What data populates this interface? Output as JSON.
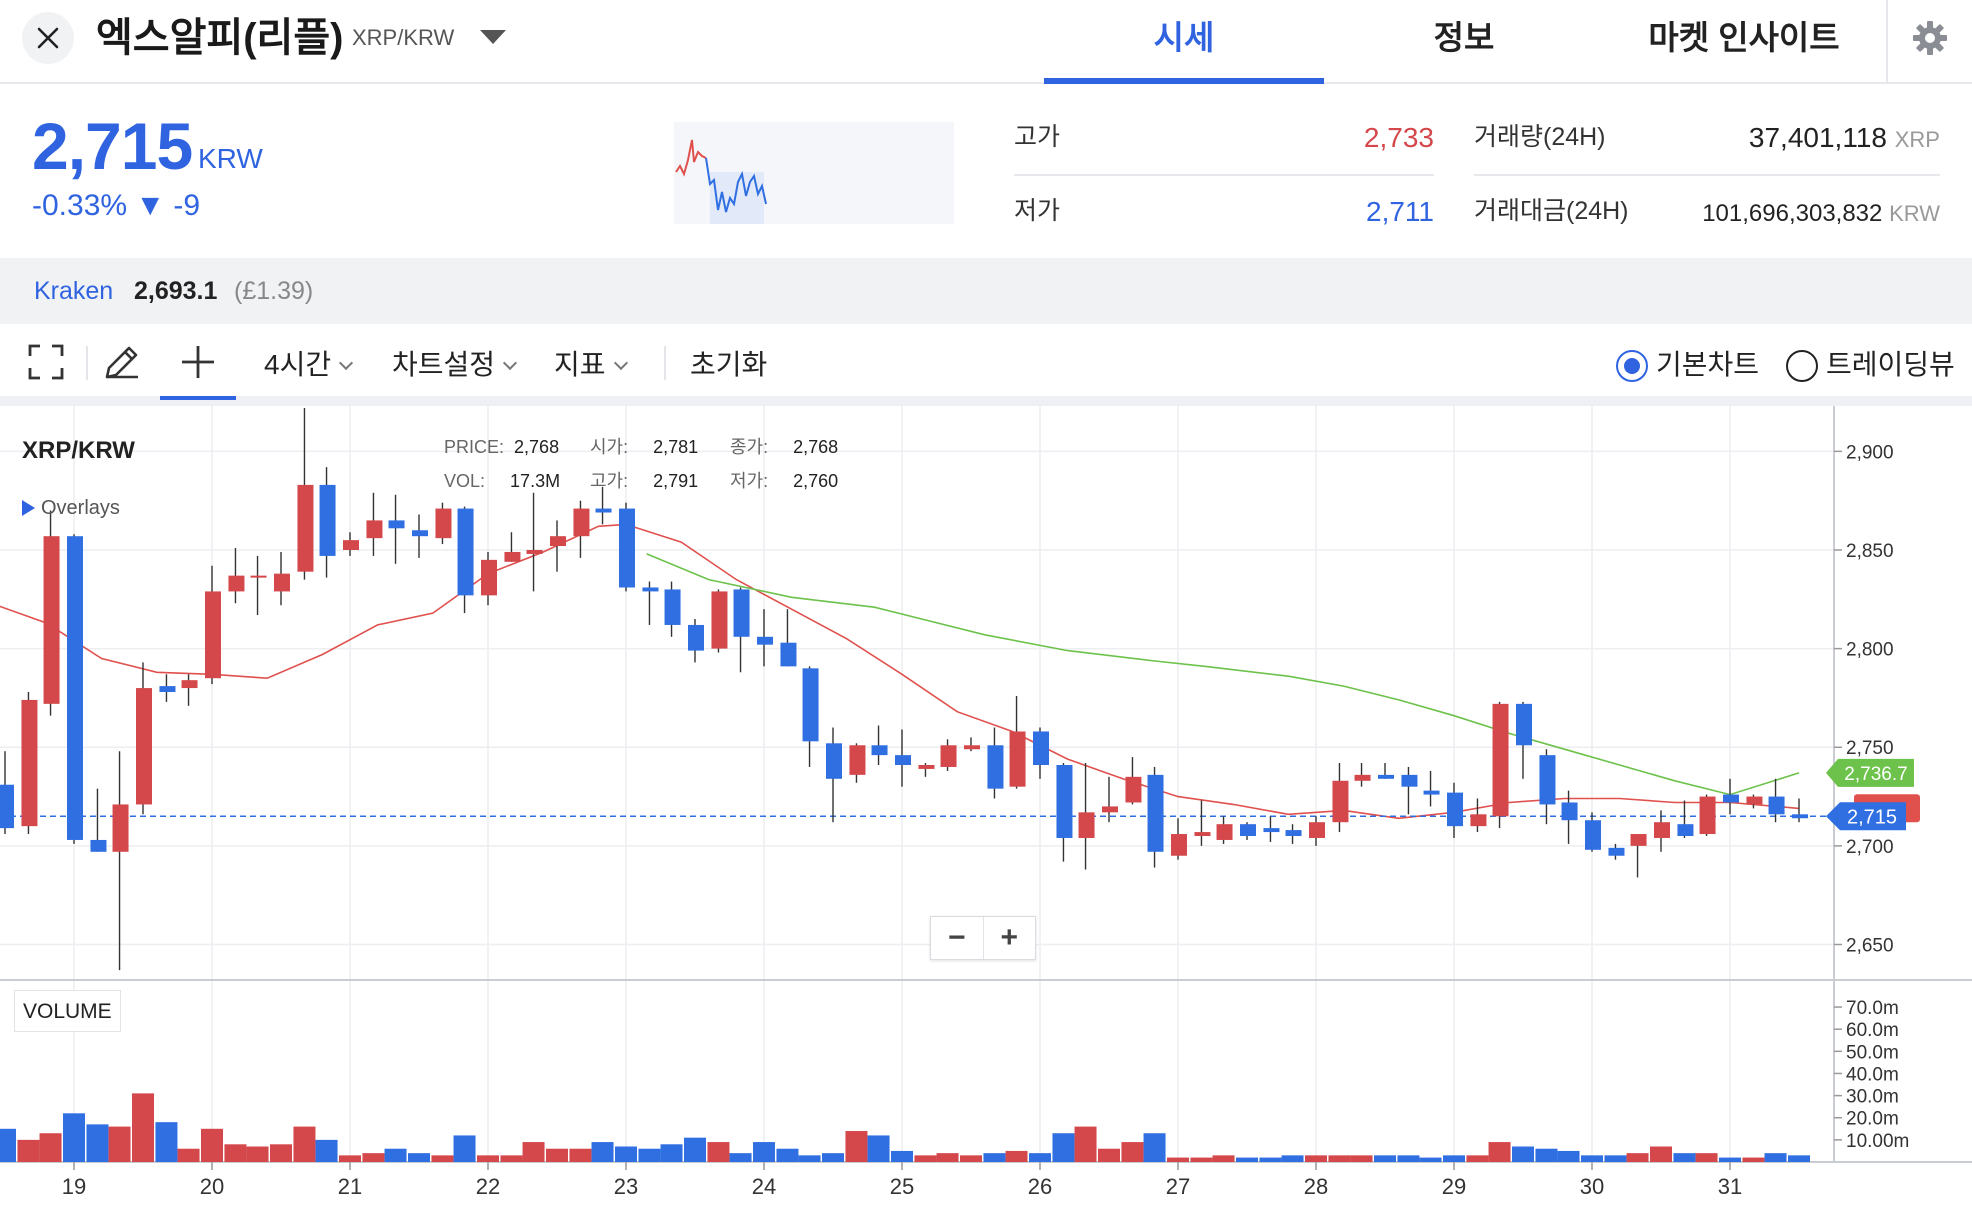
{
  "header": {
    "coin_name": "엑스알피(리플)",
    "pair": "XRP/KRW",
    "tabs": [
      {
        "label": "시세",
        "active": true
      },
      {
        "label": "정보",
        "active": false
      },
      {
        "label": "마켓 인사이트",
        "active": false
      }
    ],
    "icons": {
      "close": "close-icon",
      "caret": "caret-down-icon",
      "settings": "gear-icon"
    }
  },
  "summary": {
    "price": "2,715",
    "unit": "KRW",
    "change": "-0.33% ▼ -9",
    "high_label": "고가",
    "high_value": "2,733",
    "low_label": "저가",
    "low_value": "2,711",
    "volume_label": "거래량(24H)",
    "volume_value": "37,401,118",
    "volume_unit": "XRP",
    "amount_label": "거래대금(24H)",
    "amount_value": "101,696,303,832",
    "amount_unit": "KRW"
  },
  "kraken": {
    "name": "Kraken",
    "price": "2,693.1",
    "gbp": "(£1.39)"
  },
  "toolbar": {
    "interval": "4시간",
    "chart_settings": "차트설정",
    "indicators": "지표",
    "reset": "초기화",
    "radio_basic": "기본차트",
    "radio_tradingview": "트레이딩뷰",
    "selected_chart": "기본차트",
    "icons": [
      "fullscreen-icon",
      "pencil-icon",
      "crosshair-icon"
    ]
  },
  "chart": {
    "title": "XRP/KRW",
    "overlays": "Overlays",
    "info_price_label": "PRICE:",
    "info_price": "2,768",
    "info_open_label": "시가:",
    "info_open": "2,781",
    "info_close_label": "종가:",
    "info_close": "2,768",
    "info_vol_label": "VOL:",
    "info_vol": "17.3M",
    "info_high_label": "고가:",
    "info_high": "2,791",
    "info_low_label": "저가:",
    "info_low": "2,760",
    "zoom_out": "−",
    "zoom_in": "+",
    "volume_label": "VOLUME"
  },
  "colors": {
    "accent": "#2f63e0",
    "up": "#d4484b",
    "down": "#2f6fe2",
    "ma_short": "#e0514e",
    "ma_long": "#6cc24a"
  },
  "chart_data": {
    "type": "candlestick",
    "title": "XRP/KRW",
    "interval": "4시간",
    "x_ticks": [
      "19",
      "20",
      "21",
      "22",
      "23",
      "24",
      "25",
      "26",
      "27",
      "28",
      "29",
      "30",
      "31"
    ],
    "y_ticks": [
      "2,900",
      "2,850",
      "2,800",
      "2,750",
      "2,700",
      "2,650"
    ],
    "ylim": [
      2632,
      2923
    ],
    "volume_ticks": [
      "70.0m",
      "60.0m",
      "50.0m",
      "40.0m",
      "30.0m",
      "20.0m",
      "10.00m"
    ],
    "volume_max_m": 75,
    "candles": [
      {
        "d": 18.5,
        "o": 2731,
        "h": 2748,
        "l": 2706,
        "c": 2709
      },
      {
        "d": 18.67,
        "o": 2710,
        "h": 2778,
        "l": 2706,
        "c": 2774
      },
      {
        "d": 18.83,
        "o": 2772,
        "h": 2870,
        "l": 2766,
        "c": 2857
      },
      {
        "d": 19.0,
        "o": 2857,
        "h": 2858,
        "l": 2701,
        "c": 2703
      },
      {
        "d": 19.17,
        "o": 2703,
        "h": 2729,
        "l": 2697,
        "c": 2697
      },
      {
        "d": 19.33,
        "o": 2697,
        "h": 2748,
        "l": 2637,
        "c": 2721
      },
      {
        "d": 19.5,
        "o": 2721,
        "h": 2793,
        "l": 2716,
        "c": 2780
      },
      {
        "d": 19.67,
        "o": 2781,
        "h": 2787,
        "l": 2773,
        "c": 2778
      },
      {
        "d": 19.83,
        "o": 2780,
        "h": 2787,
        "l": 2771,
        "c": 2784
      },
      {
        "d": 20.0,
        "o": 2785,
        "h": 2842,
        "l": 2782,
        "c": 2829
      },
      {
        "d": 20.17,
        "o": 2829,
        "h": 2851,
        "l": 2823,
        "c": 2837
      },
      {
        "d": 20.33,
        "o": 2837,
        "h": 2847,
        "l": 2817,
        "c": 2837
      },
      {
        "d": 20.5,
        "o": 2829,
        "h": 2849,
        "l": 2822,
        "c": 2838
      },
      {
        "d": 20.67,
        "o": 2839,
        "h": 2922,
        "l": 2835,
        "c": 2883
      },
      {
        "d": 20.83,
        "o": 2883,
        "h": 2892,
        "l": 2836,
        "c": 2847
      },
      {
        "d": 21.0,
        "o": 2850,
        "h": 2859,
        "l": 2847,
        "c": 2855
      },
      {
        "d": 21.17,
        "o": 2856,
        "h": 2879,
        "l": 2847,
        "c": 2865
      },
      {
        "d": 21.33,
        "o": 2865,
        "h": 2878,
        "l": 2843,
        "c": 2861
      },
      {
        "d": 21.5,
        "o": 2860,
        "h": 2868,
        "l": 2846,
        "c": 2857
      },
      {
        "d": 21.67,
        "o": 2856,
        "h": 2874,
        "l": 2853,
        "c": 2871
      },
      {
        "d": 21.83,
        "o": 2871,
        "h": 2872,
        "l": 2818,
        "c": 2827
      },
      {
        "d": 22.0,
        "o": 2827,
        "h": 2849,
        "l": 2822,
        "c": 2845
      },
      {
        "d": 22.17,
        "o": 2844,
        "h": 2859,
        "l": 2844,
        "c": 2849
      },
      {
        "d": 22.33,
        "o": 2848,
        "h": 2879,
        "l": 2829,
        "c": 2850
      },
      {
        "d": 22.5,
        "o": 2852,
        "h": 2865,
        "l": 2839,
        "c": 2857
      },
      {
        "d": 22.67,
        "o": 2857,
        "h": 2875,
        "l": 2846,
        "c": 2871
      },
      {
        "d": 22.83,
        "o": 2871,
        "h": 2882,
        "l": 2863,
        "c": 2869
      },
      {
        "d": 23.0,
        "o": 2871,
        "h": 2874,
        "l": 2829,
        "c": 2831
      },
      {
        "d": 23.17,
        "o": 2831,
        "h": 2834,
        "l": 2812,
        "c": 2829
      },
      {
        "d": 23.33,
        "o": 2830,
        "h": 2834,
        "l": 2806,
        "c": 2812
      },
      {
        "d": 23.5,
        "o": 2812,
        "h": 2815,
        "l": 2793,
        "c": 2799
      },
      {
        "d": 23.67,
        "o": 2800,
        "h": 2830,
        "l": 2798,
        "c": 2829
      },
      {
        "d": 23.83,
        "o": 2830,
        "h": 2831,
        "l": 2788,
        "c": 2806
      },
      {
        "d": 24.0,
        "o": 2806,
        "h": 2820,
        "l": 2791,
        "c": 2802
      },
      {
        "d": 24.17,
        "o": 2803,
        "h": 2820,
        "l": 2791,
        "c": 2791
      },
      {
        "d": 24.33,
        "o": 2790,
        "h": 2791,
        "l": 2740,
        "c": 2753
      },
      {
        "d": 24.5,
        "o": 2752,
        "h": 2760,
        "l": 2712,
        "c": 2734
      },
      {
        "d": 24.67,
        "o": 2736,
        "h": 2752,
        "l": 2732,
        "c": 2751
      },
      {
        "d": 24.83,
        "o": 2751,
        "h": 2761,
        "l": 2741,
        "c": 2746
      },
      {
        "d": 25.0,
        "o": 2746,
        "h": 2759,
        "l": 2730,
        "c": 2741
      },
      {
        "d": 25.17,
        "o": 2739,
        "h": 2742,
        "l": 2735,
        "c": 2741
      },
      {
        "d": 25.33,
        "o": 2740,
        "h": 2754,
        "l": 2738,
        "c": 2751
      },
      {
        "d": 25.5,
        "o": 2749,
        "h": 2755,
        "l": 2748,
        "c": 2751
      },
      {
        "d": 25.67,
        "o": 2751,
        "h": 2760,
        "l": 2724,
        "c": 2729
      },
      {
        "d": 25.83,
        "o": 2730,
        "h": 2776,
        "l": 2729,
        "c": 2758
      },
      {
        "d": 26.0,
        "o": 2758,
        "h": 2760,
        "l": 2734,
        "c": 2741
      },
      {
        "d": 26.17,
        "o": 2741,
        "h": 2742,
        "l": 2692,
        "c": 2704
      },
      {
        "d": 26.33,
        "o": 2704,
        "h": 2742,
        "l": 2688,
        "c": 2717
      },
      {
        "d": 26.5,
        "o": 2717,
        "h": 2735,
        "l": 2712,
        "c": 2720
      },
      {
        "d": 26.67,
        "o": 2722,
        "h": 2745,
        "l": 2721,
        "c": 2735
      },
      {
        "d": 26.83,
        "o": 2736,
        "h": 2740,
        "l": 2689,
        "c": 2697
      },
      {
        "d": 27.0,
        "o": 2695,
        "h": 2714,
        "l": 2693,
        "c": 2706
      },
      {
        "d": 27.17,
        "o": 2705,
        "h": 2723,
        "l": 2700,
        "c": 2707
      },
      {
        "d": 27.33,
        "o": 2703,
        "h": 2715,
        "l": 2701,
        "c": 2711
      },
      {
        "d": 27.5,
        "o": 2711,
        "h": 2712,
        "l": 2703,
        "c": 2705
      },
      {
        "d": 27.67,
        "o": 2709,
        "h": 2715,
        "l": 2702,
        "c": 2707
      },
      {
        "d": 27.83,
        "o": 2708,
        "h": 2711,
        "l": 2701,
        "c": 2705
      },
      {
        "d": 28.0,
        "o": 2704,
        "h": 2715,
        "l": 2700,
        "c": 2712
      },
      {
        "d": 28.17,
        "o": 2712,
        "h": 2742,
        "l": 2707,
        "c": 2733
      },
      {
        "d": 28.33,
        "o": 2733,
        "h": 2742,
        "l": 2730,
        "c": 2736
      },
      {
        "d": 28.5,
        "o": 2736,
        "h": 2742,
        "l": 2734,
        "c": 2734
      },
      {
        "d": 28.67,
        "o": 2736,
        "h": 2740,
        "l": 2716,
        "c": 2730
      },
      {
        "d": 28.83,
        "o": 2728,
        "h": 2738,
        "l": 2720,
        "c": 2726
      },
      {
        "d": 29.0,
        "o": 2727,
        "h": 2732,
        "l": 2704,
        "c": 2710
      },
      {
        "d": 29.17,
        "o": 2710,
        "h": 2724,
        "l": 2707,
        "c": 2716
      },
      {
        "d": 29.33,
        "o": 2715,
        "h": 2773,
        "l": 2709,
        "c": 2772
      },
      {
        "d": 29.5,
        "o": 2772,
        "h": 2773,
        "l": 2734,
        "c": 2751
      },
      {
        "d": 29.67,
        "o": 2746,
        "h": 2749,
        "l": 2711,
        "c": 2721
      },
      {
        "d": 29.83,
        "o": 2722,
        "h": 2728,
        "l": 2701,
        "c": 2713
      },
      {
        "d": 30.0,
        "o": 2713,
        "h": 2717,
        "l": 2697,
        "c": 2698
      },
      {
        "d": 30.17,
        "o": 2699,
        "h": 2701,
        "l": 2693,
        "c": 2695
      },
      {
        "d": 30.33,
        "o": 2700,
        "h": 2706,
        "l": 2684,
        "c": 2706
      },
      {
        "d": 30.5,
        "o": 2704,
        "h": 2718,
        "l": 2697,
        "c": 2712
      },
      {
        "d": 30.67,
        "o": 2711,
        "h": 2723,
        "l": 2704,
        "c": 2705
      },
      {
        "d": 30.83,
        "o": 2706,
        "h": 2726,
        "l": 2705,
        "c": 2725
      },
      {
        "d": 31.0,
        "o": 2726,
        "h": 2734,
        "l": 2716,
        "c": 2722
      },
      {
        "d": 31.17,
        "o": 2721,
        "h": 2726,
        "l": 2719,
        "c": 2725
      },
      {
        "d": 31.33,
        "o": 2725,
        "h": 2734,
        "l": 2712,
        "c": 2716
      },
      {
        "d": 31.5,
        "o": 2716,
        "h": 2724,
        "l": 2712,
        "c": 2714
      }
    ],
    "volume_m": [
      15,
      10,
      13,
      22,
      17,
      16,
      31,
      18,
      6,
      15,
      8,
      7,
      8,
      16,
      10,
      3,
      4,
      6,
      4,
      3,
      12,
      3,
      3,
      9,
      6,
      6,
      9,
      7,
      6,
      8,
      11,
      9,
      4,
      9,
      6,
      3,
      4,
      14,
      12,
      5,
      3,
      4,
      3,
      4,
      5,
      4,
      13,
      16,
      6,
      9,
      13,
      2,
      2,
      3,
      2,
      2,
      3,
      3,
      3,
      3,
      3,
      3,
      2,
      3,
      3,
      9,
      7,
      6,
      5,
      3,
      3,
      4,
      7,
      4,
      4,
      2,
      2,
      4,
      3
    ],
    "ma_short": [
      [
        18.0,
        2832
      ],
      [
        18.4,
        2823
      ],
      [
        18.8,
        2813
      ],
      [
        19.2,
        2795
      ],
      [
        19.6,
        2788
      ],
      [
        20.0,
        2787
      ],
      [
        20.4,
        2785
      ],
      [
        20.8,
        2797
      ],
      [
        21.2,
        2812
      ],
      [
        21.6,
        2818
      ],
      [
        22.0,
        2838
      ],
      [
        22.4,
        2849
      ],
      [
        22.8,
        2862
      ],
      [
        23.0,
        2863
      ],
      [
        23.4,
        2854
      ],
      [
        23.8,
        2835
      ],
      [
        24.2,
        2820
      ],
      [
        24.6,
        2805
      ],
      [
        25.0,
        2787
      ],
      [
        25.4,
        2768
      ],
      [
        25.8,
        2758
      ],
      [
        26.2,
        2744
      ],
      [
        26.6,
        2734
      ],
      [
        27.0,
        2725
      ],
      [
        27.4,
        2721
      ],
      [
        27.8,
        2716
      ],
      [
        28.2,
        2718
      ],
      [
        28.6,
        2714
      ],
      [
        29.0,
        2717
      ],
      [
        29.4,
        2722
      ],
      [
        29.8,
        2724
      ],
      [
        30.2,
        2724
      ],
      [
        30.6,
        2722
      ],
      [
        31.0,
        2722
      ],
      [
        31.5,
        2719
      ]
    ],
    "ma_long": [
      [
        23.15,
        2848
      ],
      [
        23.6,
        2835
      ],
      [
        24.2,
        2826
      ],
      [
        24.8,
        2821
      ],
      [
        25.2,
        2814
      ],
      [
        25.6,
        2807
      ],
      [
        26.2,
        2799
      ],
      [
        26.8,
        2794
      ],
      [
        27.2,
        2791
      ],
      [
        27.8,
        2786
      ],
      [
        28.2,
        2781
      ],
      [
        28.6,
        2774
      ],
      [
        29.0,
        2766
      ],
      [
        29.4,
        2757
      ],
      [
        29.8,
        2749
      ],
      [
        30.2,
        2741
      ],
      [
        30.6,
        2733
      ],
      [
        31.0,
        2726
      ],
      [
        31.5,
        2737
      ]
    ],
    "current_price": 2715,
    "ma_long_last_label": "2,736.7",
    "current_price_label": "2,715"
  }
}
